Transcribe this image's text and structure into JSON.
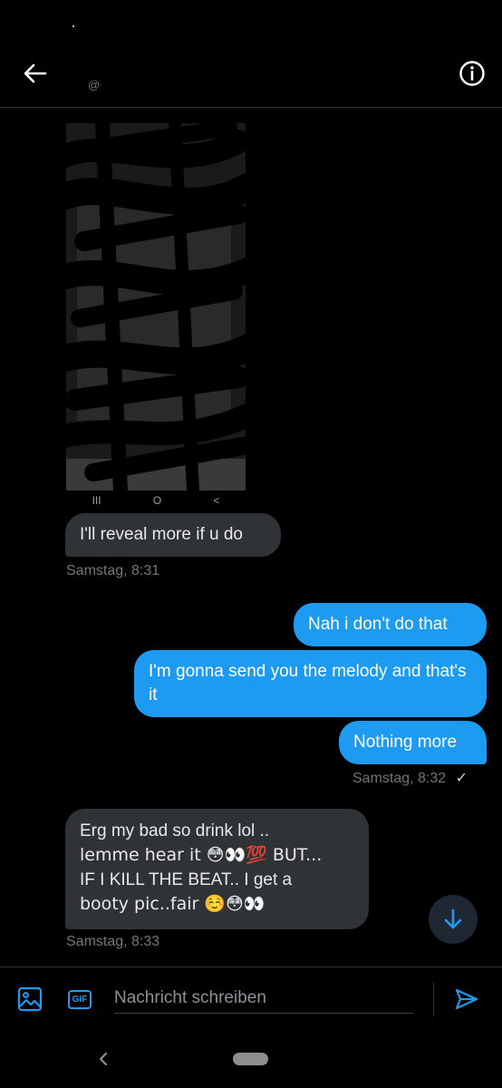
{
  "header": {
    "handle": "@⌣",
    "back_icon": "arrow-left-icon",
    "info_icon": "info-circle-icon"
  },
  "media": {
    "nav_recent": "III",
    "nav_home": "O",
    "nav_back": "<"
  },
  "messages": [
    {
      "id": "m1",
      "side": "received",
      "text": "I'll reveal more if u do"
    },
    {
      "id": "m2",
      "side": "sent",
      "text": "Nah i don't do that"
    },
    {
      "id": "m3",
      "side": "sent",
      "text": "I'm gonna send you the melody and that's it"
    },
    {
      "id": "m4",
      "side": "sent",
      "text": "Nothing more"
    },
    {
      "id": "m5",
      "side": "received",
      "lines": [
        "Erg  my bad so drink lol ..",
        "lemme hear it 😳👀💯 BUT...",
        "IF I KILL THE  BEAT.. I get a",
        "booty pic..fair ☺️😳👀"
      ]
    }
  ],
  "timestamps": {
    "t1": "Samstag, 8:31",
    "t2": "Samstag, 8:32",
    "t2_check": "✓",
    "t3": "Samstag, 8:33"
  },
  "composer": {
    "placeholder": "Nachricht schreiben",
    "gif_label": "GIF",
    "image_icon": "image-icon",
    "send_icon": "send-icon"
  },
  "colors": {
    "accent": "#1d9bf0",
    "received_bubble": "#2f3336",
    "background": "#000000",
    "muted_text": "#71767b"
  }
}
